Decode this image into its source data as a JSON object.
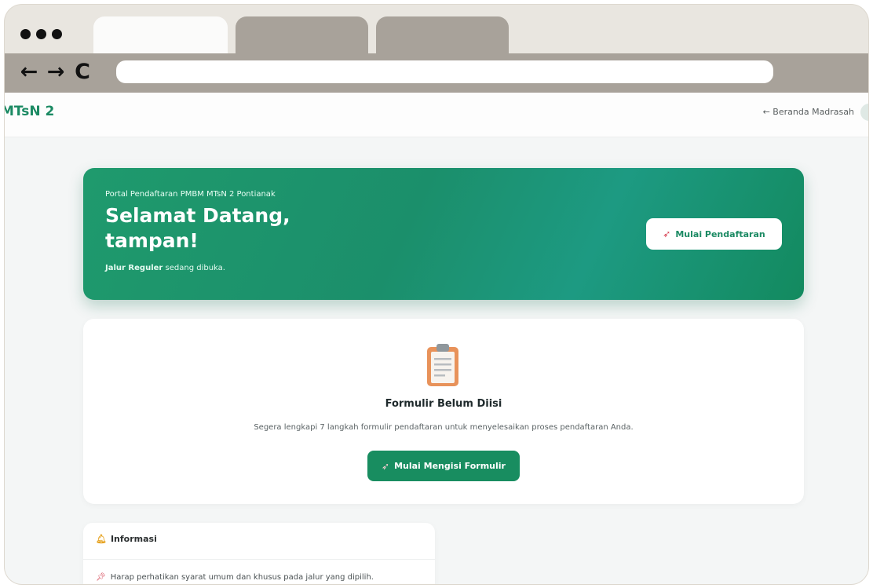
{
  "browser": {
    "nav": {
      "back": "←",
      "forward": "→",
      "reload": "C"
    },
    "url": ""
  },
  "site": {
    "brand": "MTsN 2",
    "home_link": "← Beranda Madrasah"
  },
  "hero": {
    "eyebrow": "Portal Pendaftaran PMBM MTsN 2 Pontianak",
    "greeting_line1": "Selamat Datang,",
    "greeting_line2": "tampan!",
    "status_bold": "Jalur Reguler",
    "status_rest": " sedang dibuka.",
    "button_label": "Mulai Pendaftaran"
  },
  "form_card": {
    "title": "Formulir Belum Diisi",
    "description": "Segera lengkapi 7 langkah formulir pendaftaran untuk menyelesaikan proses pendaftaran Anda.",
    "button_label": "Mulai Mengisi Formulir"
  },
  "info": {
    "title": "Informasi",
    "items": [
      "Harap perhatikan syarat umum dan khusus pada jalur yang dipilih."
    ]
  },
  "colors": {
    "brand_green": "#1b8a63",
    "browser_chrome": "#a8a29a",
    "frame": "#e9e6e0"
  },
  "icons": {
    "hero_button": "rocket-icon",
    "form_card": "clipboard-icon",
    "cta": "rocket-icon",
    "info_title": "bell-icon",
    "info_item": "pin-icon"
  }
}
